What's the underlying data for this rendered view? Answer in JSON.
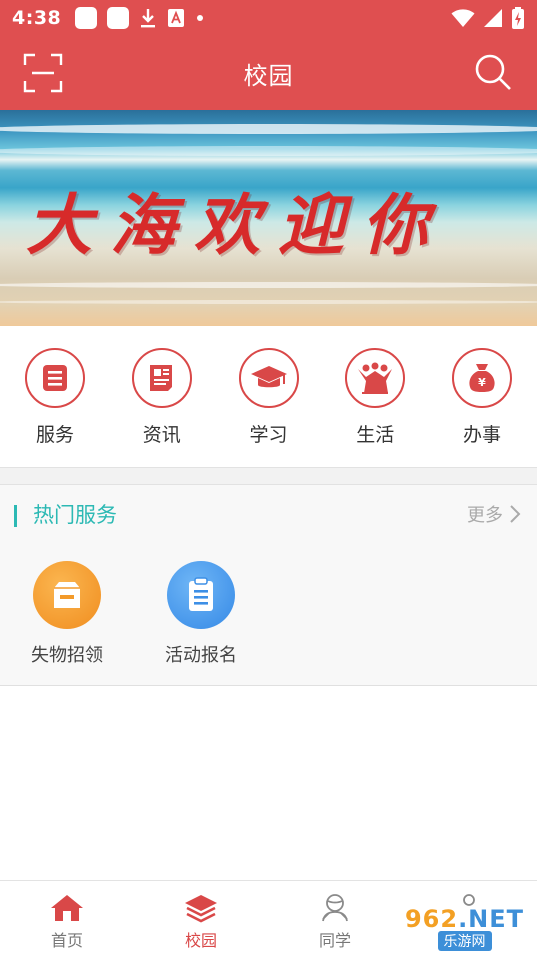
{
  "status_bar": {
    "time": "4:38"
  },
  "header": {
    "title": "校园",
    "left_icon": "scan-icon",
    "right_icon": "search-icon"
  },
  "banner": {
    "text": "大海欢迎你"
  },
  "categories": [
    {
      "label": "服务",
      "icon": "list-icon"
    },
    {
      "label": "资讯",
      "icon": "newspaper-icon"
    },
    {
      "label": "学习",
      "icon": "graduation-cap-icon"
    },
    {
      "label": "生活",
      "icon": "people-icon"
    },
    {
      "label": "办事",
      "icon": "money-bag-icon"
    }
  ],
  "hot_services": {
    "title": "热门服务",
    "more_label": "更多",
    "items": [
      {
        "label": "失物招领",
        "icon": "box-icon",
        "color": "#f6a23c"
      },
      {
        "label": "活动报名",
        "icon": "clipboard-icon",
        "color": "#4a9ff0"
      }
    ]
  },
  "tabs": [
    {
      "label": "首页",
      "icon": "home-icon"
    },
    {
      "label": "校园",
      "icon": "layers-icon",
      "active": true
    },
    {
      "label": "同学",
      "icon": "classmates-icon"
    },
    {
      "label": "",
      "icon": "user-icon"
    }
  ],
  "watermark": {
    "top": "962.NET",
    "bottom": "乐游网"
  },
  "colors": {
    "primary": "#df4f50",
    "accent": "#2cb9b4",
    "icon_red": "#d94848"
  }
}
